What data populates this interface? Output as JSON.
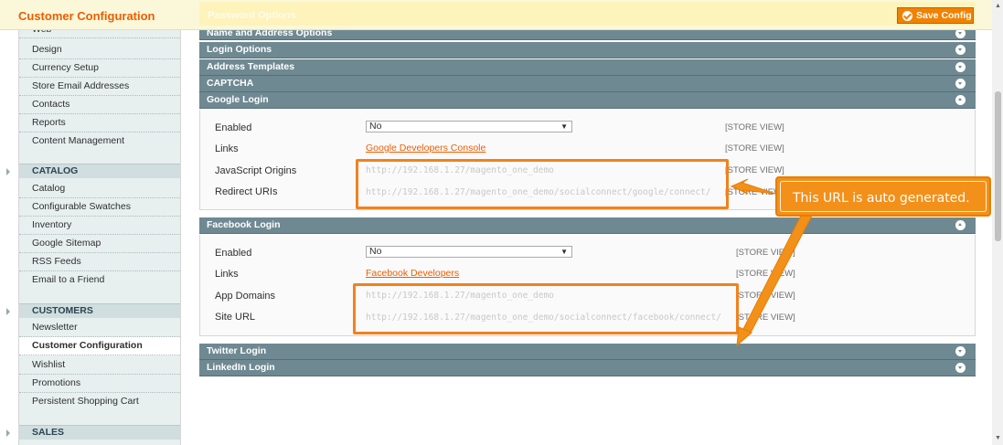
{
  "page": {
    "title": "Customer Configuration"
  },
  "toolbar": {
    "save_label": "Save Config"
  },
  "top_ghost_section": "Password Options",
  "nav": {
    "items_top": [
      "Web",
      "Design",
      "Currency Setup",
      "Store Email Addresses",
      "Contacts",
      "Reports",
      "Content Management"
    ],
    "catalog_group": "CATALOG",
    "catalog_items": [
      "Catalog",
      "Configurable Swatches",
      "Inventory",
      "Google Sitemap",
      "RSS Feeds",
      "Email to a Friend"
    ],
    "customers_group": "CUSTOMERS",
    "customers_items": [
      "Newsletter",
      "Customer Configuration",
      "Wishlist",
      "Promotions",
      "Persistent Shopping Cart"
    ],
    "active_item": "Customer Configuration",
    "sales_group": "SALES"
  },
  "sections": {
    "name_address": "Name and Address Options",
    "login_options": "Login Options",
    "address_templates": "Address Templates",
    "captcha": "CAPTCHA",
    "google_login": "Google Login",
    "facebook_login": "Facebook Login",
    "twitter_login": "Twitter Login",
    "linkedin_login": "LinkedIn Login"
  },
  "google": {
    "enabled_label": "Enabled",
    "enabled_value": "No",
    "links_label": "Links",
    "links_value": "Google Developers Console",
    "js_origins_label": "JavaScript Origins",
    "js_origins_value": "http://192.168.1.27/magento_one_demo",
    "redirect_label": "Redirect URIs",
    "redirect_value": "http://192.168.1.27/magento_one_demo/socialconnect/google/connect/",
    "scope": "[STORE VIEW]"
  },
  "facebook": {
    "enabled_label": "Enabled",
    "enabled_value": "No",
    "links_label": "Links",
    "links_value": "Facebook Developers",
    "app_domains_label": "App Domains",
    "app_domains_value": "http://192.168.1.27/magento_one_demo",
    "site_url_label": "Site URL",
    "site_url_value": "http://192.168.1.27/magento_one_demo/socialconnect/facebook/connect/",
    "scope": "[STORE VIEW]"
  },
  "callout": {
    "text": "This URL is auto generated."
  },
  "colors": {
    "accent": "#eb5e00",
    "section_header": "#6f8992",
    "callout": "#f39019"
  }
}
